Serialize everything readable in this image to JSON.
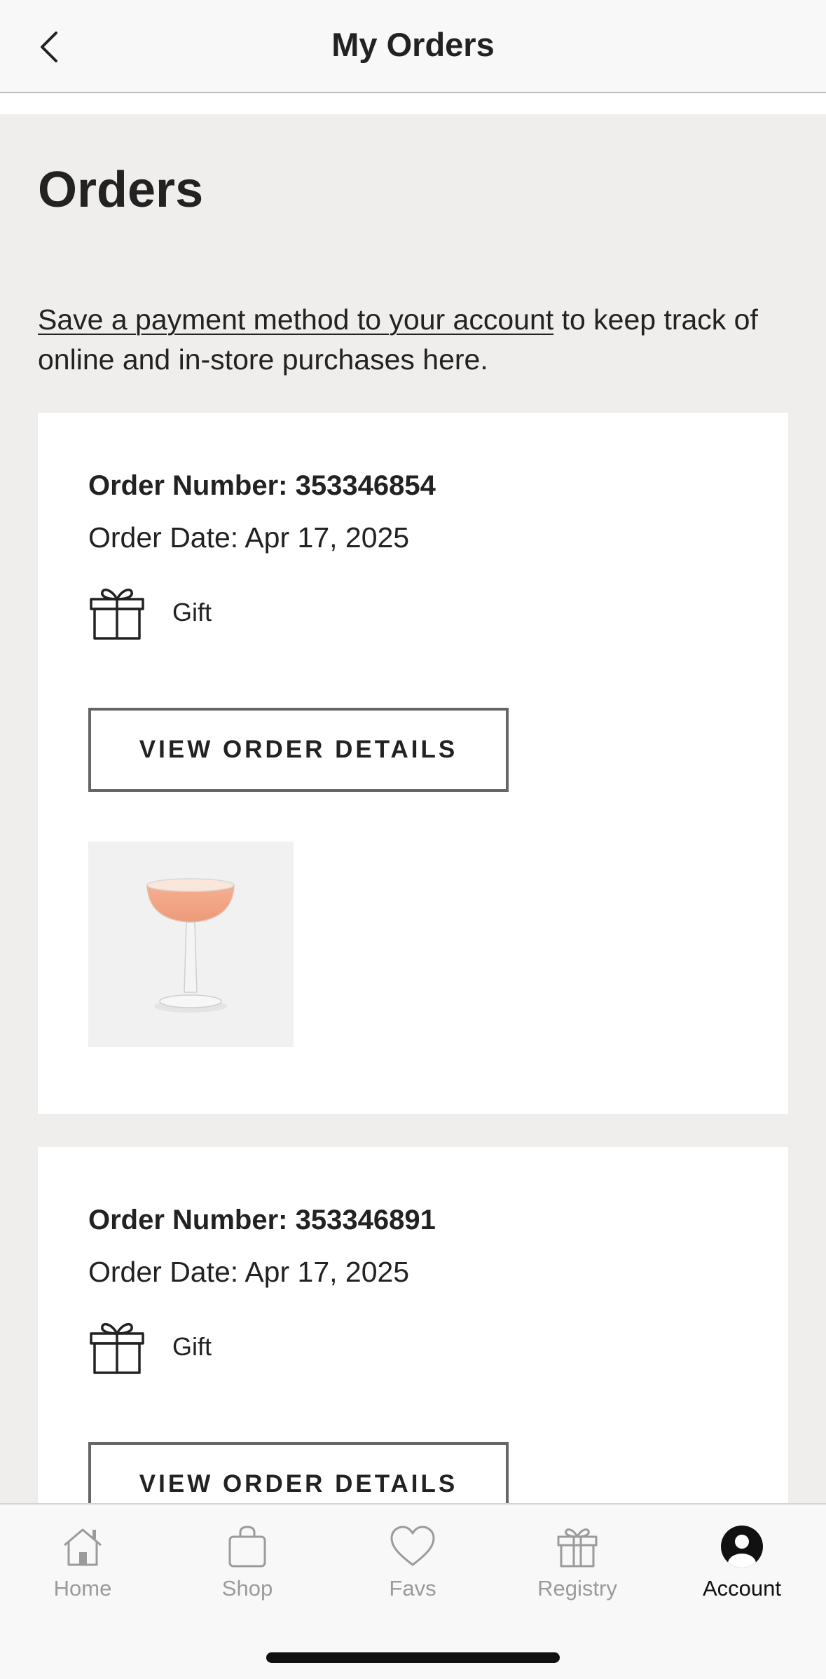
{
  "header": {
    "title": "My Orders",
    "back_icon": "chevron-left-icon"
  },
  "main": {
    "title": "Orders",
    "intro_link": "Save a payment method to your account",
    "intro_text": " to keep track of online and in-store purchases here."
  },
  "orders": [
    {
      "number": "Order Number: 353346854",
      "date": "Order Date: Apr 17, 2025",
      "gift_label": "Gift",
      "button_label": "VIEW ORDER DETAILS",
      "product_icon": "coupe-glass-image"
    },
    {
      "number": "Order Number: 353346891",
      "date": "Order Date: Apr 17, 2025",
      "gift_label": "Gift",
      "button_label": "VIEW ORDER DETAILS"
    }
  ],
  "tabbar": {
    "items": [
      {
        "label": "Home",
        "icon": "home-icon",
        "active": false
      },
      {
        "label": "Shop",
        "icon": "shopping-bag-icon",
        "active": false
      },
      {
        "label": "Favs",
        "icon": "heart-icon",
        "active": false
      },
      {
        "label": "Registry",
        "icon": "gift-icon",
        "active": false
      },
      {
        "label": "Account",
        "icon": "account-icon",
        "active": true
      }
    ]
  },
  "colors": {
    "page_bg": "#efeeec",
    "card_bg": "#ffffff",
    "text": "#222222",
    "inactive_tab": "#9b9b9b",
    "active_tab": "#111111"
  }
}
